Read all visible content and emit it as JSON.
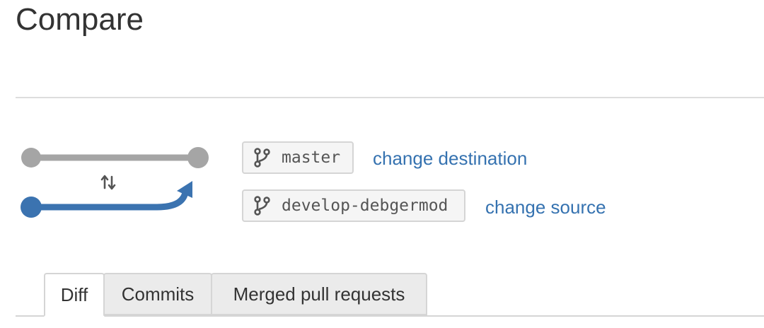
{
  "page": {
    "title": "Compare"
  },
  "branches": {
    "destination": {
      "name": "master",
      "change_link": "change destination"
    },
    "source": {
      "name": "develop-debgermod",
      "change_link": "change source"
    }
  },
  "tabs": [
    {
      "label": "Diff",
      "active": true
    },
    {
      "label": "Commits",
      "active": false
    },
    {
      "label": "Merged pull requests",
      "active": false
    }
  ],
  "icons": {
    "branch": "branch-icon",
    "swap": "swap-arrows-icon"
  },
  "colors": {
    "destination_line": "#a5a5a5",
    "source_line": "#3b73b0",
    "link": "#3572b0"
  }
}
